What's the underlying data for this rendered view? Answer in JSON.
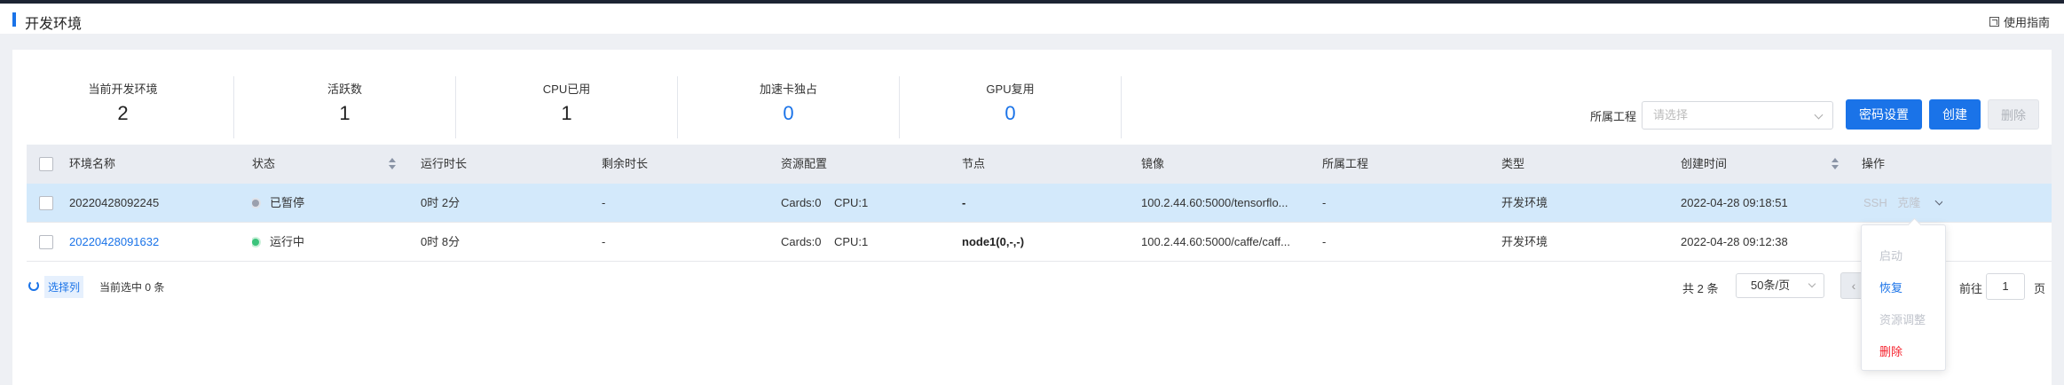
{
  "header": {
    "title": "开发环境",
    "guide_label": "使用指南"
  },
  "stats": [
    {
      "label": "当前开发环境",
      "value": "2",
      "accent": false
    },
    {
      "label": "活跃数",
      "value": "1",
      "accent": false
    },
    {
      "label": "CPU已用",
      "value": "1",
      "accent": false
    },
    {
      "label": "加速卡独占",
      "value": "0",
      "accent": true
    },
    {
      "label": "GPU复用",
      "value": "0",
      "accent": true
    }
  ],
  "filter": {
    "label": "所属工程",
    "placeholder": "请选择"
  },
  "toolbar": {
    "password_label": "密码设置",
    "create_label": "创建",
    "delete_label": "删除"
  },
  "table": {
    "columns": [
      "环境名称",
      "状态",
      "运行时长",
      "剩余时长",
      "资源配置",
      "节点",
      "镜像",
      "所属工程",
      "类型",
      "创建时间",
      "操作"
    ],
    "rows": [
      {
        "name": "20220428092245",
        "status": "已暂停",
        "status_color": "gray",
        "runtime": "0时 2分",
        "remaining": "-",
        "resources": "Cards:0    CPU:1",
        "node": "-",
        "image": "100.2.44.60:5000/tensorflo...",
        "project": "-",
        "type": "开发环境",
        "created": "2022-04-28 09:18:51",
        "ops": [
          "SSH",
          "克隆"
        ]
      },
      {
        "name": "20220428091632",
        "status": "运行中",
        "status_color": "green",
        "runtime": "0时 8分",
        "remaining": "-",
        "resources": "Cards:0    CPU:1",
        "node": "node1(0,-,-)",
        "image": "100.2.44.60:5000/caffe/caff...",
        "project": "-",
        "type": "开发环境",
        "created": "2022-04-28 09:12:38",
        "ops": []
      }
    ]
  },
  "footer": {
    "select_columns": "选择列",
    "selected_count": "当前选中 0 条",
    "total": "共 2 条",
    "page_size": "50条/页",
    "prev": "‹",
    "goto_label": "前往",
    "page": "1",
    "page_unit": "页"
  },
  "action_menu": {
    "items": [
      {
        "label": "启动",
        "state": "disabled"
      },
      {
        "label": "恢复",
        "state": "enabled"
      },
      {
        "label": "资源调整",
        "state": "disabled"
      },
      {
        "label": "删除",
        "state": "danger"
      }
    ]
  },
  "colors": {
    "accent": "#1a73e8",
    "danger": "#f5222d",
    "selected_row": "#d3e9fb",
    "header_bg": "#e9ecf2"
  }
}
